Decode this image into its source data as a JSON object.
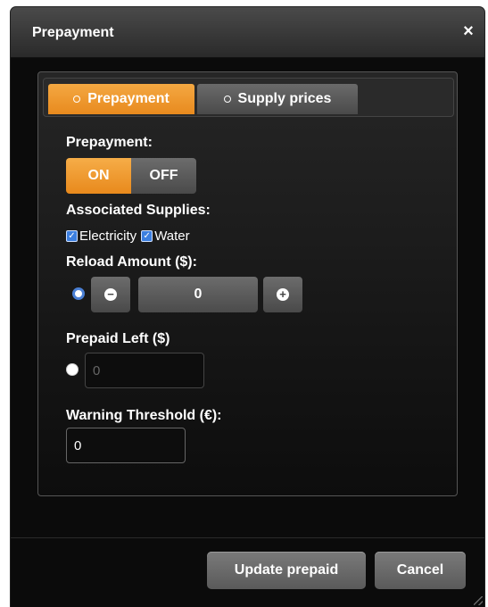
{
  "dialog": {
    "title": "Prepayment",
    "close_symbol": "×"
  },
  "tabs": [
    {
      "label": "Prepayment",
      "active": true
    },
    {
      "label": "Supply prices",
      "active": false
    }
  ],
  "form": {
    "prepayment_label": "Prepayment:",
    "toggle_on": "ON",
    "toggle_off": "OFF",
    "toggle_selected": "ON",
    "supplies_label": "Associated Supplies:",
    "supplies": [
      {
        "label": "Electricity",
        "checked": true
      },
      {
        "label": "Water",
        "checked": true
      }
    ],
    "reload_label": "Reload Amount ($):",
    "reload_value": "0",
    "minus_symbol": "−",
    "plus_symbol": "+",
    "prepaid_left_label": "Prepaid Left ($)",
    "prepaid_left_value": "0",
    "warning_label": "Warning Threshold (€):",
    "warning_value": "0"
  },
  "footer": {
    "update_label": "Update prepaid",
    "cancel_label": "Cancel"
  },
  "colors": {
    "accent": "#e88a1e",
    "radio_selected": "#4a7fd4",
    "checkbox": "#3c7fe0"
  }
}
